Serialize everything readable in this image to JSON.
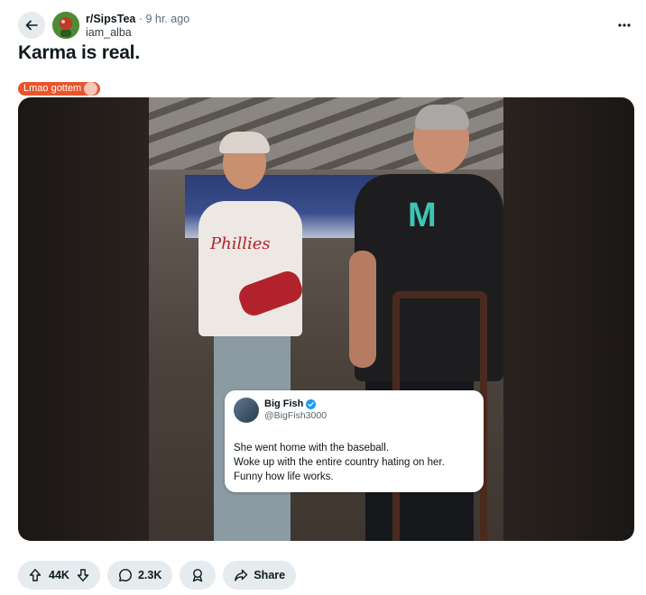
{
  "header": {
    "subreddit": "r/SipsTea",
    "separator": "·",
    "time_ago": "9 hr. ago",
    "username": "iam_alba"
  },
  "post": {
    "title": "Karma is real.",
    "flair": "Lmao gottem"
  },
  "media": {
    "shirt_text": "Phillies",
    "logo_text": "M",
    "tweet": {
      "name": "Big Fish",
      "handle": "@BigFish3000",
      "lines": [
        "She went home with the baseball.",
        "Woke up with the entire country hating on her.",
        "Funny how life works."
      ]
    }
  },
  "actions": {
    "upvotes": "44K",
    "comments": "2.3K",
    "share_label": "Share"
  },
  "icons": {
    "back": "arrow-left-icon",
    "more": "ellipsis-icon",
    "upvote": "arrow-up-icon",
    "downvote": "arrow-down-icon",
    "comment": "speech-bubble-icon",
    "award": "award-icon",
    "share": "share-arrow-icon",
    "verified": "verified-badge-icon"
  },
  "colors": {
    "flair_bg": "#e8542b",
    "pill_bg": "#e5ebee",
    "verified_blue": "#1d9bf0"
  }
}
